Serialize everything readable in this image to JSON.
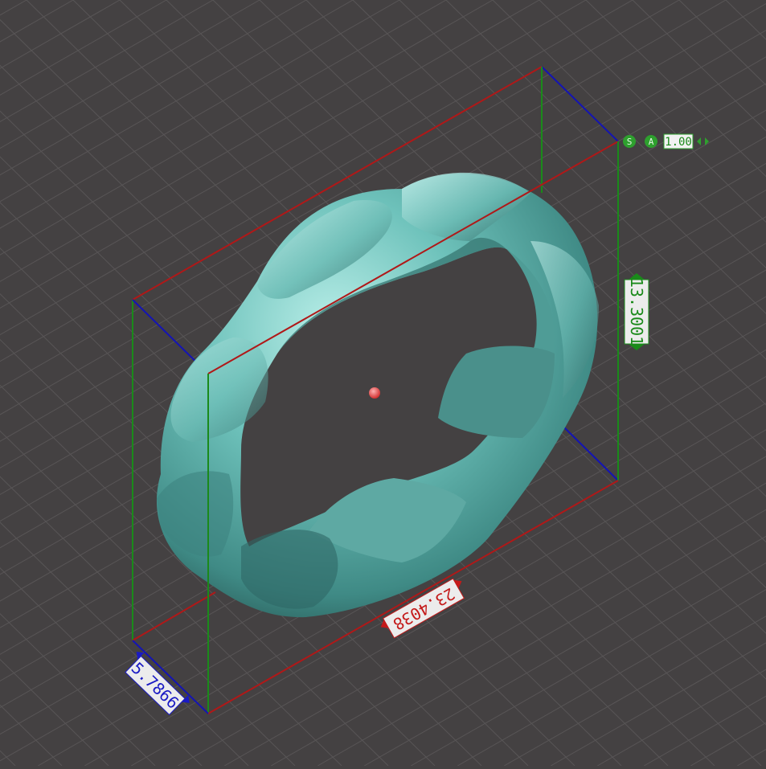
{
  "viewport": {
    "background": "#444142",
    "grid_color": "#5a5758",
    "mesh_color": "#5fb3ad",
    "pivot_color": "#e64444"
  },
  "bounding_box": {
    "x_axis_color": "#b01818",
    "y_axis_color": "#1a8a1a",
    "z_axis_color": "#1414b4"
  },
  "dimensions": {
    "width": "23.4038",
    "height": "13.3001",
    "depth": "5.7866"
  },
  "scale_toolbar": {
    "scale_button": "S",
    "auto_button": "A",
    "scale_value": "1.00"
  }
}
